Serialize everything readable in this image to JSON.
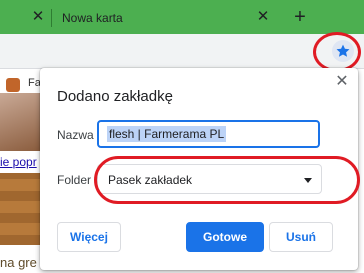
{
  "tabs": [
    {
      "label": ""
    },
    {
      "label": "Nowa karta"
    }
  ],
  "toolbar": {
    "bookmark_icon": "star-icon",
    "accent": "#1a73e8"
  },
  "background_page": {
    "tab_text": "Fa",
    "link_text": "ie popr",
    "bottom_text": "na gre"
  },
  "dialog": {
    "title": "Dodano zakładkę",
    "name_label": "Nazwa",
    "name_value": "flesh | Farmerama PL",
    "folder_label": "Folder",
    "folder_value": "Pasek zakładek",
    "more_button": "Więcej",
    "done_button": "Gotowe",
    "remove_button": "Usuń"
  },
  "annotation_color": "#e01b24"
}
